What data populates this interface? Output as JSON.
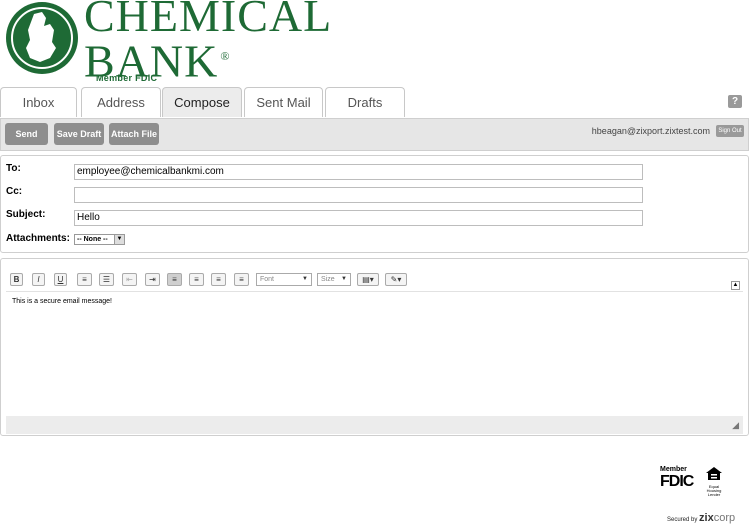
{
  "brand": {
    "name_line1": "CHEMICAL",
    "name_line2": "BANK",
    "reg_mark": "®",
    "member": "Member FDIC",
    "color": "#1e6a35"
  },
  "tabs": [
    {
      "label": "Inbox",
      "active": false
    },
    {
      "label": "Address",
      "active": false
    },
    {
      "label": "Compose",
      "active": true
    },
    {
      "label": "Sent Mail",
      "active": false
    },
    {
      "label": "Drafts",
      "active": false
    }
  ],
  "help_label": "?",
  "toolbar": {
    "send_label": "Send",
    "save_draft_label": "Save Draft",
    "attach_file_label": "Attach File",
    "user_email": "hbeagan@zixport.zixtest.com",
    "sign_out_label": "Sign Out"
  },
  "form": {
    "to_label": "To:",
    "to_value": "employee@chemicalbankmi.com",
    "cc_label": "Cc:",
    "cc_value": "",
    "subject_label": "Subject:",
    "subject_value": "Hello",
    "attachments_label": "Attachments:",
    "attachments_selected": "-- None --"
  },
  "editor": {
    "toolbar": {
      "bold": "B",
      "italic": "I",
      "underline": "U",
      "font_placeholder": "Font",
      "size_placeholder": "Size"
    },
    "body": "This is a secure email message!"
  },
  "footer": {
    "fdic_member": "Member",
    "fdic": "FDIC",
    "equal_housing": "Equal Housing Lender",
    "secured_by": "Secured by",
    "zix": "zix",
    "corp": "corp"
  }
}
